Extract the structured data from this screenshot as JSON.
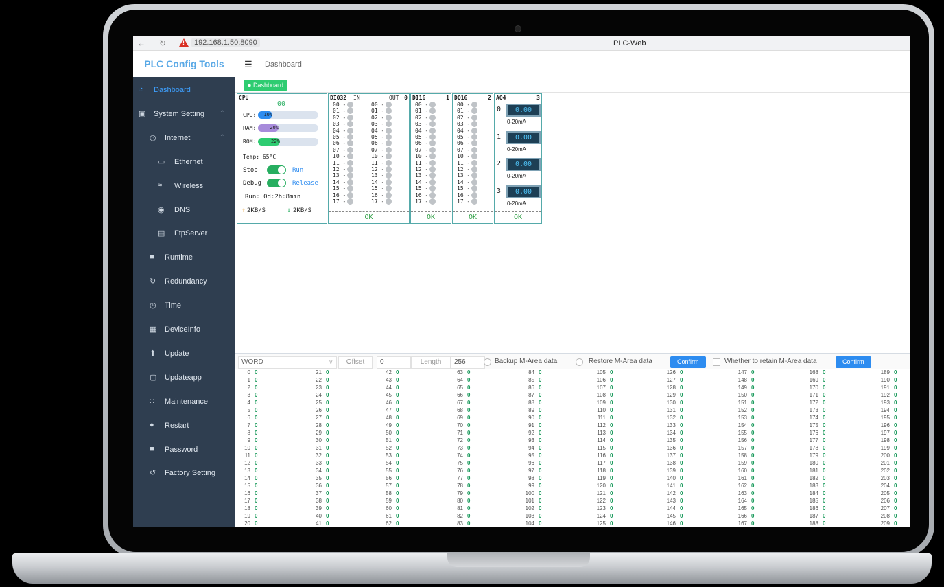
{
  "browser": {
    "url": "192.168.1.50:8090",
    "title": "PLC-Web"
  },
  "app": {
    "brand": "PLC Config Tools",
    "breadcrumb": "Dashboard",
    "tab": "Dashboard"
  },
  "sidebar": [
    {
      "label": "Dashboard",
      "icon": "dashboard-icon",
      "active": true,
      "level": 0
    },
    {
      "label": "System Setting",
      "icon": "monitor-icon",
      "level": 0,
      "expanded": true
    },
    {
      "label": "Internet",
      "icon": "globe-icon",
      "level": 1,
      "expanded": true
    },
    {
      "label": "Ethernet",
      "icon": "ethernet-icon",
      "level": 2
    },
    {
      "label": "Wireless",
      "icon": "wifi-icon",
      "level": 2
    },
    {
      "label": "DNS",
      "icon": "dns-icon",
      "level": 2
    },
    {
      "label": "FtpServer",
      "icon": "server-icon",
      "level": 2
    },
    {
      "label": "Runtime",
      "icon": "runtime-icon",
      "level": 1
    },
    {
      "label": "Redundancy",
      "icon": "sync-icon",
      "level": 1
    },
    {
      "label": "Time",
      "icon": "clock-icon",
      "level": 1
    },
    {
      "label": "DeviceInfo",
      "icon": "info-card-icon",
      "level": 1
    },
    {
      "label": "Update",
      "icon": "upload-icon",
      "level": 1
    },
    {
      "label": "Updateapp",
      "icon": "app-icon",
      "level": 1
    },
    {
      "label": "Maintenance",
      "icon": "maintenance-icon",
      "level": 1
    },
    {
      "label": "Restart",
      "icon": "restart-icon",
      "level": 1
    },
    {
      "label": "Password",
      "icon": "lock-icon",
      "level": 1
    },
    {
      "label": "Factory Setting",
      "icon": "reset-icon",
      "level": 1
    }
  ],
  "cpu": {
    "title": "CPU",
    "indicator": "00",
    "cpu_label": "CPU:",
    "cpu_value": "10%",
    "cpu_pct": 10,
    "ram_label": "RAM:",
    "ram_value": "20%",
    "ram_pct": 20,
    "rom_label": "ROM:",
    "rom_value": "22%",
    "rom_pct": 22,
    "temp": "Temp: 65°C",
    "stop_label": "Stop",
    "run_label": "Run",
    "debug_label": "Debug",
    "release_label": "Release",
    "runtime": "Run: 0d:2h:8min",
    "upload": "2KB/S",
    "download": "2KB/S"
  },
  "modules": [
    {
      "title": "DIO32",
      "num": "0",
      "in": "IN",
      "out": "OUT",
      "status": "OK"
    },
    {
      "title": "DI16",
      "num": "1",
      "status": "OK"
    },
    {
      "title": "DQ16",
      "num": "2",
      "status": "OK"
    },
    {
      "title": "AQ4",
      "num": "3",
      "status": "OK",
      "channels": [
        {
          "ch": "0",
          "value": "0.00",
          "range": "0-20mA"
        },
        {
          "ch": "1",
          "value": "0.00",
          "range": "0-20mA"
        },
        {
          "ch": "2",
          "value": "0.00",
          "range": "0-20mA"
        },
        {
          "ch": "3",
          "value": "0.00",
          "range": "0-20mA"
        }
      ]
    }
  ],
  "channel_labels": [
    "00",
    "01",
    "02",
    "03",
    "04",
    "05",
    "06",
    "07",
    "10",
    "11",
    "12",
    "13",
    "14",
    "15",
    "16",
    "17"
  ],
  "marea": {
    "type_value": "WORD",
    "offset_label": "Offset",
    "offset_value": "0",
    "length_label": "Length",
    "length_value": "256",
    "backup_label": "Backup M-Area data",
    "restore_label": "Restore M-Area data",
    "confirm1": "Confirm",
    "retain_label": "Whether to retain M-Area data",
    "confirm2": "Confirm",
    "cell_value": "0"
  }
}
